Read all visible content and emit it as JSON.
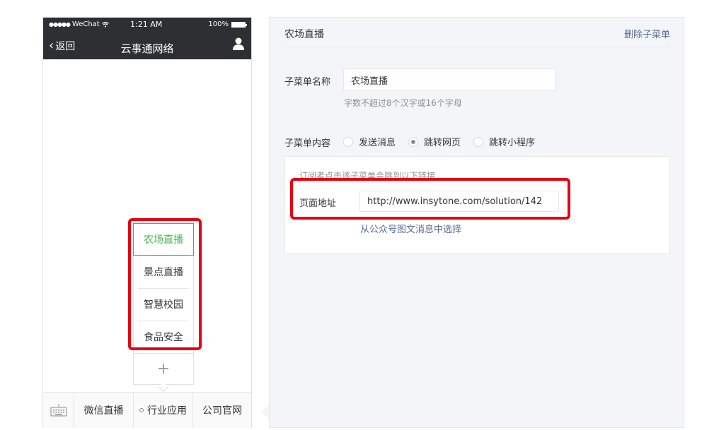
{
  "phone": {
    "status": {
      "signal": "●●●●●",
      "carrier": "WeChat",
      "time": "1:21 AM",
      "battery": "100%"
    },
    "nav": {
      "back_label": "返回",
      "title": "云事通网络"
    },
    "submenu": {
      "items": [
        {
          "label": "农场直播",
          "active": true
        },
        {
          "label": "景点直播",
          "active": false
        },
        {
          "label": "智慧校园",
          "active": false
        },
        {
          "label": "食品安全",
          "active": false
        }
      ],
      "add_label": "+"
    },
    "footer": {
      "tabs": [
        {
          "label": "微信直播"
        },
        {
          "label": "行业应用"
        },
        {
          "label": "公司官网"
        }
      ]
    }
  },
  "editor": {
    "title": "农场直播",
    "delete_label": "删除子菜单",
    "name_label": "子菜单名称",
    "name_value": "农场直播",
    "name_hint": "字数不超过8个汉字或16个字母",
    "content_label": "子菜单内容",
    "radio_options": [
      {
        "label": "发送消息",
        "checked": false
      },
      {
        "label": "跳转网页",
        "checked": true
      },
      {
        "label": "跳转小程序",
        "checked": false
      }
    ],
    "link_desc": "订阅者点击该子菜单会跳到以下链接",
    "url_label": "页面地址",
    "url_value": "http://www.insytone.com/solution/142",
    "select_link_label": "从公众号图文消息中选择"
  },
  "colors": {
    "header_bg": "#2e2f33",
    "active_green": "#44b549",
    "link_blue": "#576b95",
    "highlight_red": "#e60012",
    "panel_bg": "#f4f5f9"
  }
}
